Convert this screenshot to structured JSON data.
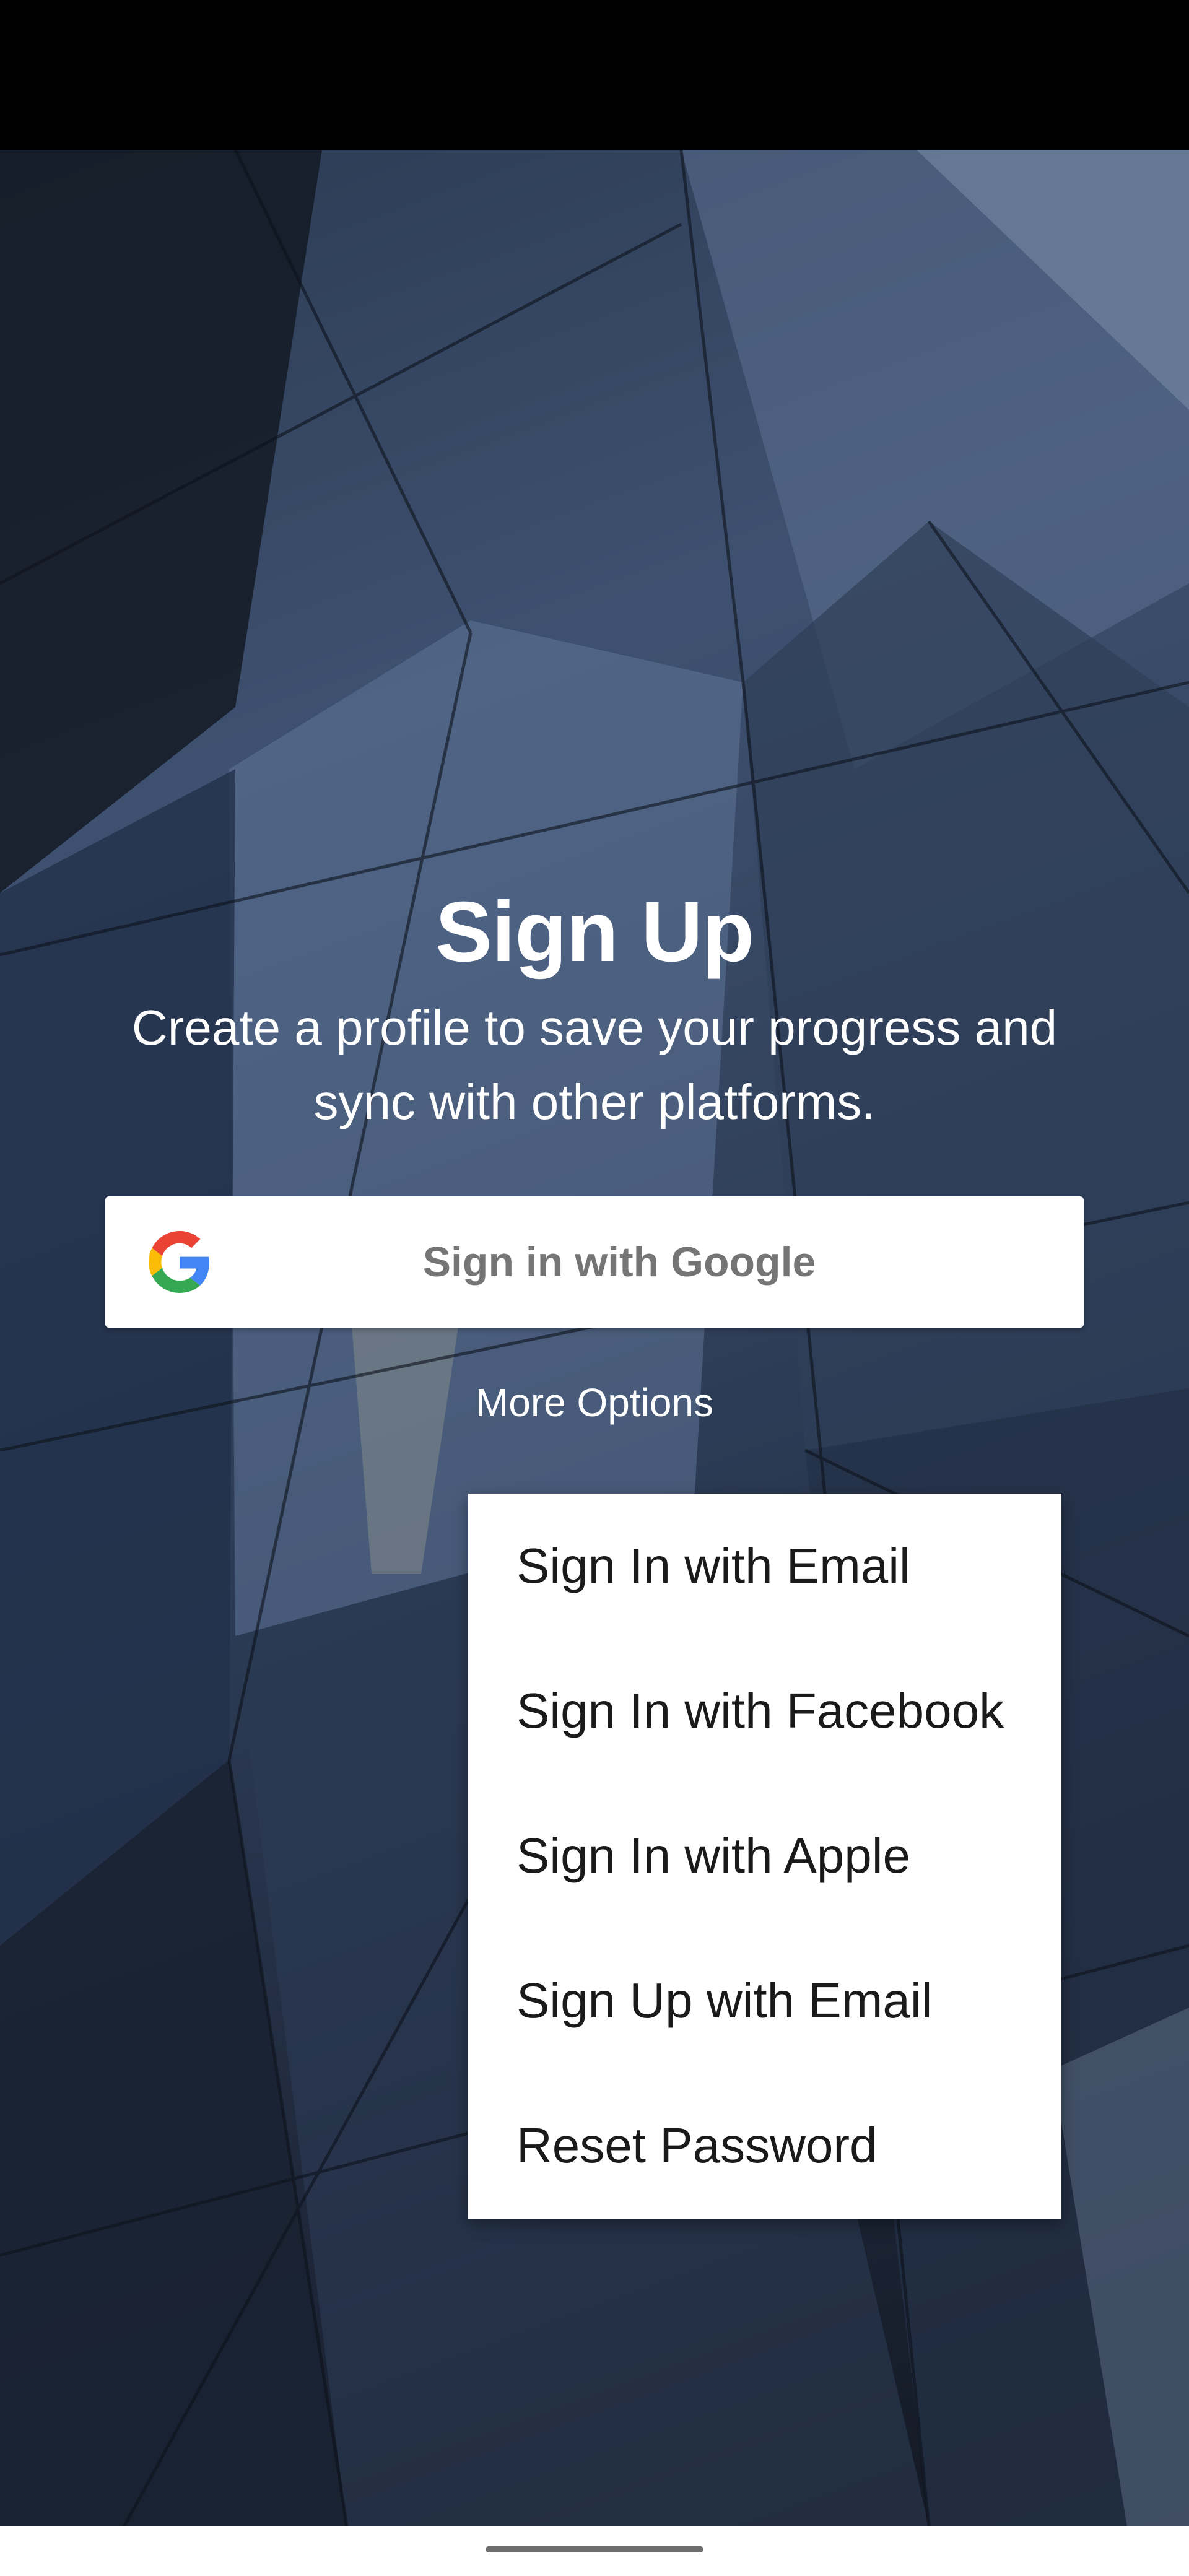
{
  "signup": {
    "title": "Sign Up",
    "subtitle": "Create a profile to save your progress and sync with other platforms.",
    "google_button_label": "Sign in with Google",
    "more_options_label": "More Options"
  },
  "menu": {
    "items": [
      {
        "label": "Sign In with Email"
      },
      {
        "label": "Sign In with Facebook"
      },
      {
        "label": "Sign In with Apple"
      },
      {
        "label": "Sign Up with Email"
      },
      {
        "label": "Reset Password"
      }
    ]
  },
  "icons": {
    "google": "google-g-icon"
  },
  "colors": {
    "background_dark": "#1d2638",
    "background_mid": "#3e5170",
    "button_text": "#757575",
    "menu_text": "#1a1a1a",
    "google_blue": "#4285F4",
    "google_red": "#EA4335",
    "google_yellow": "#FBBC05",
    "google_green": "#34A853"
  }
}
